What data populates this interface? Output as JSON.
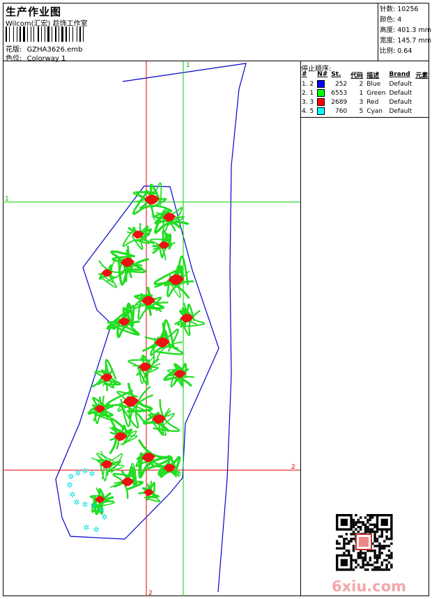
{
  "header": {
    "title": "生产作业图",
    "company": "Wilcom(汇宏) 趁饰工作室",
    "design_label": "花版:",
    "design_file": "GZHA3626.emb",
    "colorway_label": "色位:",
    "colorway": "Colorway 1"
  },
  "stats": {
    "stitches_label": "针数:",
    "stitches": "10256",
    "colors_label": "颜色:",
    "colors": "4",
    "height_label": "高度:",
    "height": "401.3 mm",
    "width_label": "宽度:",
    "width": "145.7 mm",
    "scale_label": "比例:",
    "scale": "0.64"
  },
  "stop_sequence": {
    "title": "停止顺序:",
    "headers": [
      "#",
      "N#",
      "St.",
      "代码",
      "描述",
      "Brand",
      "元素"
    ],
    "rows": [
      {
        "no": "1. 2",
        "color": "#0000ff",
        "st": "252",
        "code": "2",
        "desc": "Blue",
        "brand": "Default"
      },
      {
        "no": "2. 1",
        "color": "#00ff00",
        "st": "6553",
        "code": "1",
        "desc": "Green",
        "brand": "Default"
      },
      {
        "no": "3. 3",
        "color": "#ff0000",
        "st": "2689",
        "code": "3",
        "desc": "Red",
        "brand": "Default"
      },
      {
        "no": "4. 5",
        "color": "#00ffff",
        "st": "760",
        "code": "5",
        "desc": "Cyan",
        "brand": "Default"
      }
    ]
  },
  "guides": {
    "green_top": "1",
    "green_left": "1",
    "red_right": "2",
    "red_bottom": "2"
  },
  "watermark": "6xiu.com"
}
